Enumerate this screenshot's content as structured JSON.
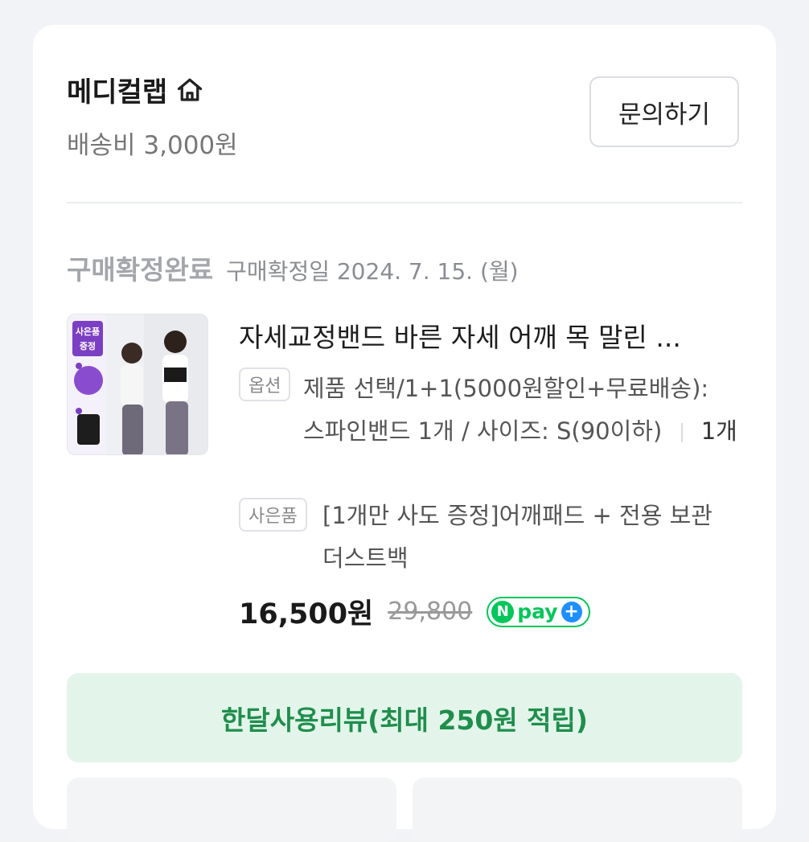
{
  "store": {
    "name": "메디컬랩",
    "shipping": "배송비 3,000원",
    "inquiry_label": "문의하기"
  },
  "order": {
    "status": "구매확정완료",
    "confirm_date": "구매확정일 2024. 7. 15. (월)"
  },
  "product": {
    "title": "자세교정밴드 바른 자세 어깨 목 말린 ...",
    "thumb_badge_line1": "사은품",
    "thumb_badge_line2": "증정",
    "option_tag": "옵션",
    "option_text": "제품 선택/1+1(5000원할인+무료배송): 스파인밴드 1개 / 사이즈: S(90이하)",
    "quantity": "1개",
    "gift_tag": "사은품",
    "gift_text": "[1개만 사도 증정]어깨패드 + 전용 보관 더스트백",
    "price": "16,500원",
    "original_price": "29,800",
    "pay_badge": "pay"
  },
  "review_button": "한달사용리뷰(최대 250원 적립)",
  "colors": {
    "accent_green": "#1f8e4d",
    "review_bg": "#e3f5ea",
    "npay_green": "#03c75a",
    "npay_blue": "#1e8fff"
  }
}
